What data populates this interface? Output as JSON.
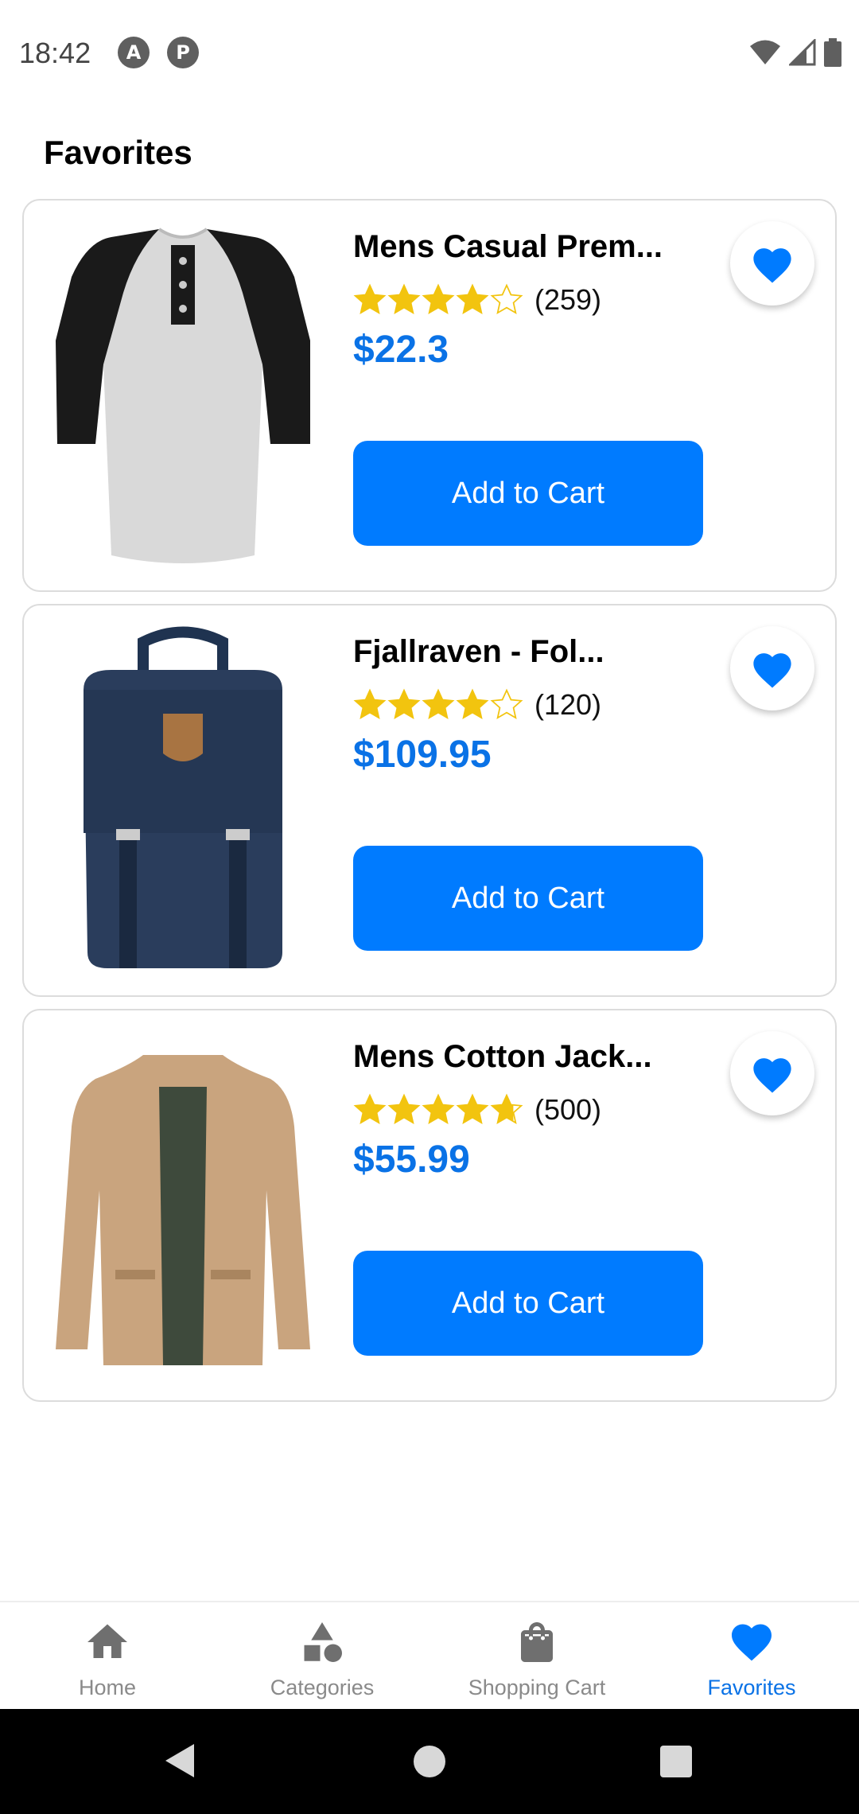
{
  "status_bar": {
    "time": "18:42",
    "notification_icons": [
      "A",
      "P"
    ]
  },
  "page": {
    "title": "Favorites"
  },
  "favorites": [
    {
      "title": "Mens Casual Prem...",
      "image": "raglan-henley-tshirt",
      "rating": 4.1,
      "rating_count": "(259)",
      "price": "$22.3",
      "button_label": "Add to Cart"
    },
    {
      "title": "Fjallraven - Fol...",
      "image": "navy-backpack",
      "rating": 3.9,
      "rating_count": "(120)",
      "price": "$109.95",
      "button_label": "Add to Cart"
    },
    {
      "title": "Mens Cotton Jack...",
      "image": "khaki-jacket",
      "rating": 4.7,
      "rating_count": "(500)",
      "price": "$55.99",
      "button_label": "Add to Cart"
    }
  ],
  "bottom_nav": {
    "items": [
      {
        "label": "Home",
        "icon": "home-icon",
        "active": false
      },
      {
        "label": "Categories",
        "icon": "categories-icon",
        "active": false
      },
      {
        "label": "Shopping Cart",
        "icon": "shopping-bag-icon",
        "active": false
      },
      {
        "label": "Favorites",
        "icon": "heart-icon",
        "active": true
      }
    ]
  },
  "colors": {
    "accent": "#007bff",
    "price": "#0a72e6",
    "star": "#f2c40f",
    "nav_inactive": "#8a8a8a"
  }
}
